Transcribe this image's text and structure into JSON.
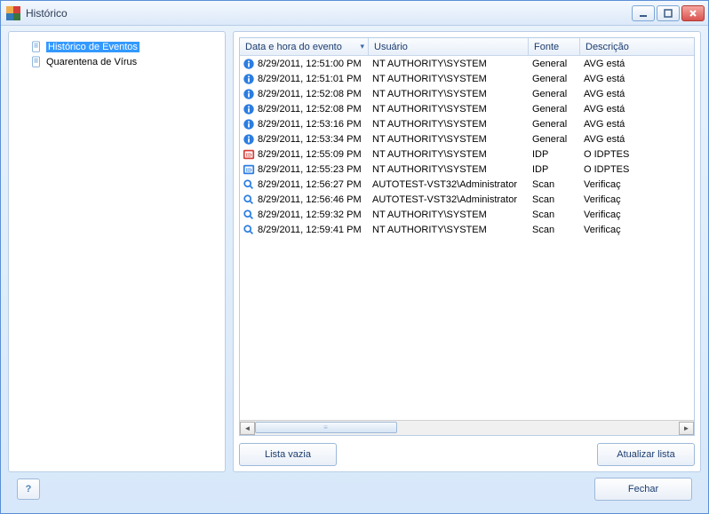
{
  "window": {
    "title": "Histórico"
  },
  "tree": {
    "items": [
      {
        "label": "Histórico de Eventos",
        "selected": true
      },
      {
        "label": "Quarentena de Vírus",
        "selected": false
      }
    ]
  },
  "grid": {
    "columns": {
      "date": "Data e hora do evento",
      "user": "Usuário",
      "source": "Fonte",
      "desc": "Descrição"
    },
    "rows": [
      {
        "icon": "info",
        "date": "8/29/2011, 12:51:00 PM",
        "user": "NT AUTHORITY\\SYSTEM",
        "source": "General",
        "desc": "AVG está"
      },
      {
        "icon": "info",
        "date": "8/29/2011, 12:51:01 PM",
        "user": "NT AUTHORITY\\SYSTEM",
        "source": "General",
        "desc": "AVG está"
      },
      {
        "icon": "info",
        "date": "8/29/2011, 12:52:08 PM",
        "user": "NT AUTHORITY\\SYSTEM",
        "source": "General",
        "desc": "AVG está"
      },
      {
        "icon": "info",
        "date": "8/29/2011, 12:52:08 PM",
        "user": "NT AUTHORITY\\SYSTEM",
        "source": "General",
        "desc": "AVG está"
      },
      {
        "icon": "info",
        "date": "8/29/2011, 12:53:16 PM",
        "user": "NT AUTHORITY\\SYSTEM",
        "source": "General",
        "desc": "AVG está"
      },
      {
        "icon": "info",
        "date": "8/29/2011, 12:53:34 PM",
        "user": "NT AUTHORITY\\SYSTEM",
        "source": "General",
        "desc": "AVG está"
      },
      {
        "icon": "idp-red",
        "date": "8/29/2011, 12:55:09 PM",
        "user": "NT AUTHORITY\\SYSTEM",
        "source": "IDP",
        "desc": "O IDPTES"
      },
      {
        "icon": "idp-blue",
        "date": "8/29/2011, 12:55:23 PM",
        "user": "NT AUTHORITY\\SYSTEM",
        "source": "IDP",
        "desc": "O IDPTES"
      },
      {
        "icon": "search",
        "date": "8/29/2011, 12:56:27 PM",
        "user": "AUTOTEST-VST32\\Administrator",
        "source": "Scan",
        "desc": "Verificaç"
      },
      {
        "icon": "search",
        "date": "8/29/2011, 12:56:46 PM",
        "user": "AUTOTEST-VST32\\Administrator",
        "source": "Scan",
        "desc": "Verificaç"
      },
      {
        "icon": "search",
        "date": "8/29/2011, 12:59:32 PM",
        "user": "NT AUTHORITY\\SYSTEM",
        "source": "Scan",
        "desc": "Verificaç"
      },
      {
        "icon": "search",
        "date": "8/29/2011, 12:59:41 PM",
        "user": "NT AUTHORITY\\SYSTEM",
        "source": "Scan",
        "desc": "Verificaç"
      }
    ]
  },
  "buttons": {
    "empty_list": "Lista vazia",
    "refresh_list": "Atualizar lista",
    "close": "Fechar"
  }
}
